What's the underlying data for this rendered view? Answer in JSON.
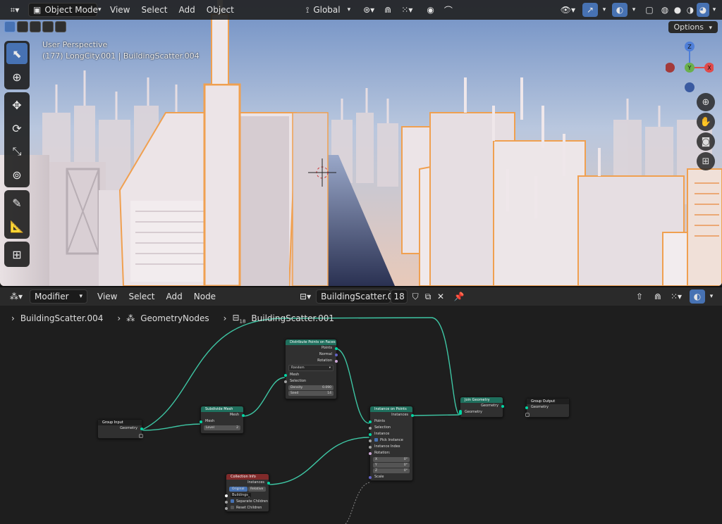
{
  "viewport": {
    "mode_label": "Object Mode",
    "menus": [
      "View",
      "Select",
      "Add",
      "Object"
    ],
    "transform_orientation": "Global",
    "options_label": "Options",
    "overlay_line1": "User Perspective",
    "overlay_line2": "(177) LongCity.001 | BuildingScatter.004",
    "axis": {
      "x": "X",
      "y": "Y",
      "z": "Z"
    }
  },
  "node_editor": {
    "editor_type": "Modifier",
    "menus": [
      "View",
      "Select",
      "Add",
      "Node"
    ],
    "node_group_name": "BuildingScatter.001",
    "user_count": "18",
    "breadcrumb": {
      "object": "BuildingScatter.004",
      "modifier": "GeometryNodes",
      "group": "BuildingScatter.001",
      "group_users": "18"
    }
  },
  "nodes": {
    "group_input": {
      "title": "Group Input",
      "geometry": "Geometry"
    },
    "subdivide": {
      "title": "Subdivide Mesh",
      "out_mesh": "Mesh",
      "in_mesh": "Mesh",
      "level_label": "Level",
      "level_value": "2"
    },
    "distribute": {
      "title": "Distribute Points on Faces",
      "out_points": "Points",
      "out_normal": "Normal",
      "out_rotation": "Rotation",
      "method": "Random",
      "in_mesh": "Mesh",
      "selection": "Selection",
      "density_label": "Density",
      "density_value": "0.090",
      "seed_label": "Seed",
      "seed_value": "14"
    },
    "instance": {
      "title": "Instance on Points",
      "out_instances": "Instances",
      "points": "Points",
      "selection": "Selection",
      "instance": "Instance",
      "pick_instance": "Pick Instance",
      "instance_index": "Instance Index",
      "rotation": "Rotation:",
      "rx_label": "X",
      "rx": "0°",
      "ry_label": "Y",
      "ry": "0°",
      "rz_label": "Z",
      "rz": "0°",
      "scale": "Scale"
    },
    "join": {
      "title": "Join Geometry",
      "out_geometry": "Geometry",
      "in_geometry": "Geometry"
    },
    "group_output": {
      "title": "Group Output",
      "geometry": "Geometry"
    },
    "collection": {
      "title": "Collection Info",
      "out_instances": "Instances",
      "mode_original": "Original",
      "mode_relative": "Relative",
      "collection_value": "Buildings_",
      "separate_children": "Separate Children",
      "reset_children": "Reset Children"
    }
  }
}
